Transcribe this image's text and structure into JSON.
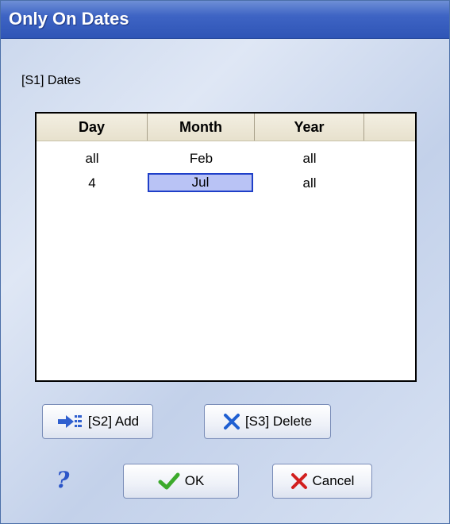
{
  "window": {
    "title": "Only On Dates"
  },
  "group": {
    "label": "[S1] Dates"
  },
  "grid": {
    "columns": [
      "Day",
      "Month",
      "Year"
    ],
    "rows": [
      [
        "all",
        "Feb",
        "all"
      ],
      [
        "4",
        "Jul",
        "all"
      ]
    ],
    "selected": {
      "row": 1,
      "column": 1
    }
  },
  "buttons": {
    "add": "[S2] Add",
    "delete": "[S3] Delete",
    "ok": "OK",
    "cancel": "Cancel",
    "help": "?"
  },
  "colors": {
    "title_bar": "#3e64c4",
    "selection_fill": "#b9c3f5",
    "selection_border": "#1f3fc8",
    "ok_check": "#3caa2c",
    "cancel_x": "#d21f1f",
    "delete_x": "#1f5fd2"
  },
  "icons": {
    "add": "add-arrow-icon",
    "delete": "delete-x-icon",
    "ok": "checkmark-icon",
    "cancel": "cancel-x-icon",
    "help": "help-question-icon"
  }
}
